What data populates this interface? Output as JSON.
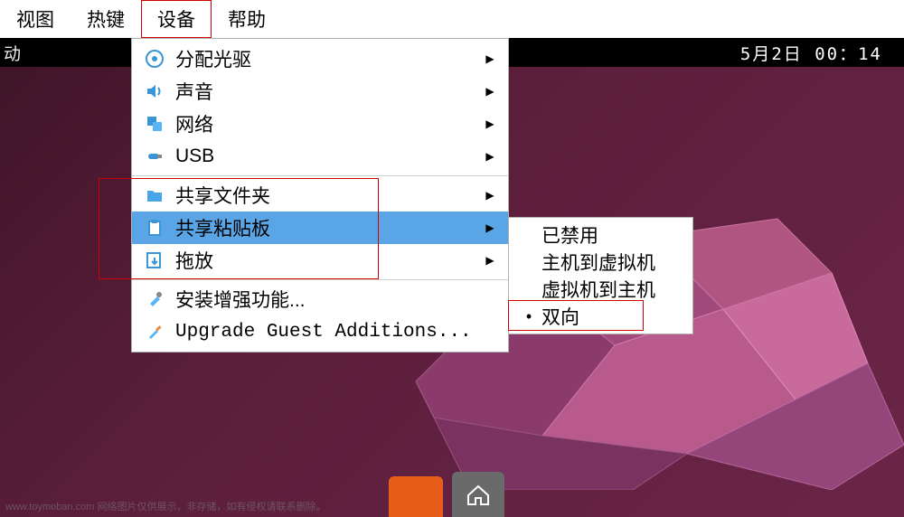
{
  "menubar": {
    "items": [
      "视图",
      "热键",
      "设备",
      "帮助"
    ],
    "active_index": 2
  },
  "guest_bar": {
    "left_stub": "动",
    "clock": "5月2日  00：14"
  },
  "device_menu": {
    "items": [
      {
        "icon": "disc-icon",
        "label": "分配光驱",
        "has_sub": true
      },
      {
        "icon": "sound-icon",
        "label": "声音",
        "has_sub": true
      },
      {
        "icon": "network-icon",
        "label": "网络",
        "has_sub": true
      },
      {
        "icon": "usb-icon",
        "label": "USB",
        "has_sub": true
      },
      {
        "sep": true
      },
      {
        "icon": "folder-icon",
        "label": "共享文件夹",
        "has_sub": true
      },
      {
        "icon": "clipboard-icon",
        "label": "共享粘贴板",
        "has_sub": true,
        "highlight": true
      },
      {
        "icon": "dragdrop-icon",
        "label": "拖放",
        "has_sub": true
      },
      {
        "sep": true
      },
      {
        "icon": "tool-icon",
        "label": "安装增强功能...",
        "has_sub": false
      },
      {
        "icon": "screwdriver-icon",
        "label": "Upgrade Guest Additions...",
        "has_sub": false,
        "mono": true
      }
    ]
  },
  "clipboard_submenu": {
    "items": [
      {
        "label": "已禁用",
        "checked": false
      },
      {
        "label": "主机到虚拟机",
        "checked": false
      },
      {
        "label": "虚拟机到主机",
        "checked": false
      },
      {
        "label": "双向",
        "checked": true
      }
    ]
  },
  "watermark": "www.toymoban.com 网络图片仅供展示，非存储，如有侵权请联系删除。"
}
